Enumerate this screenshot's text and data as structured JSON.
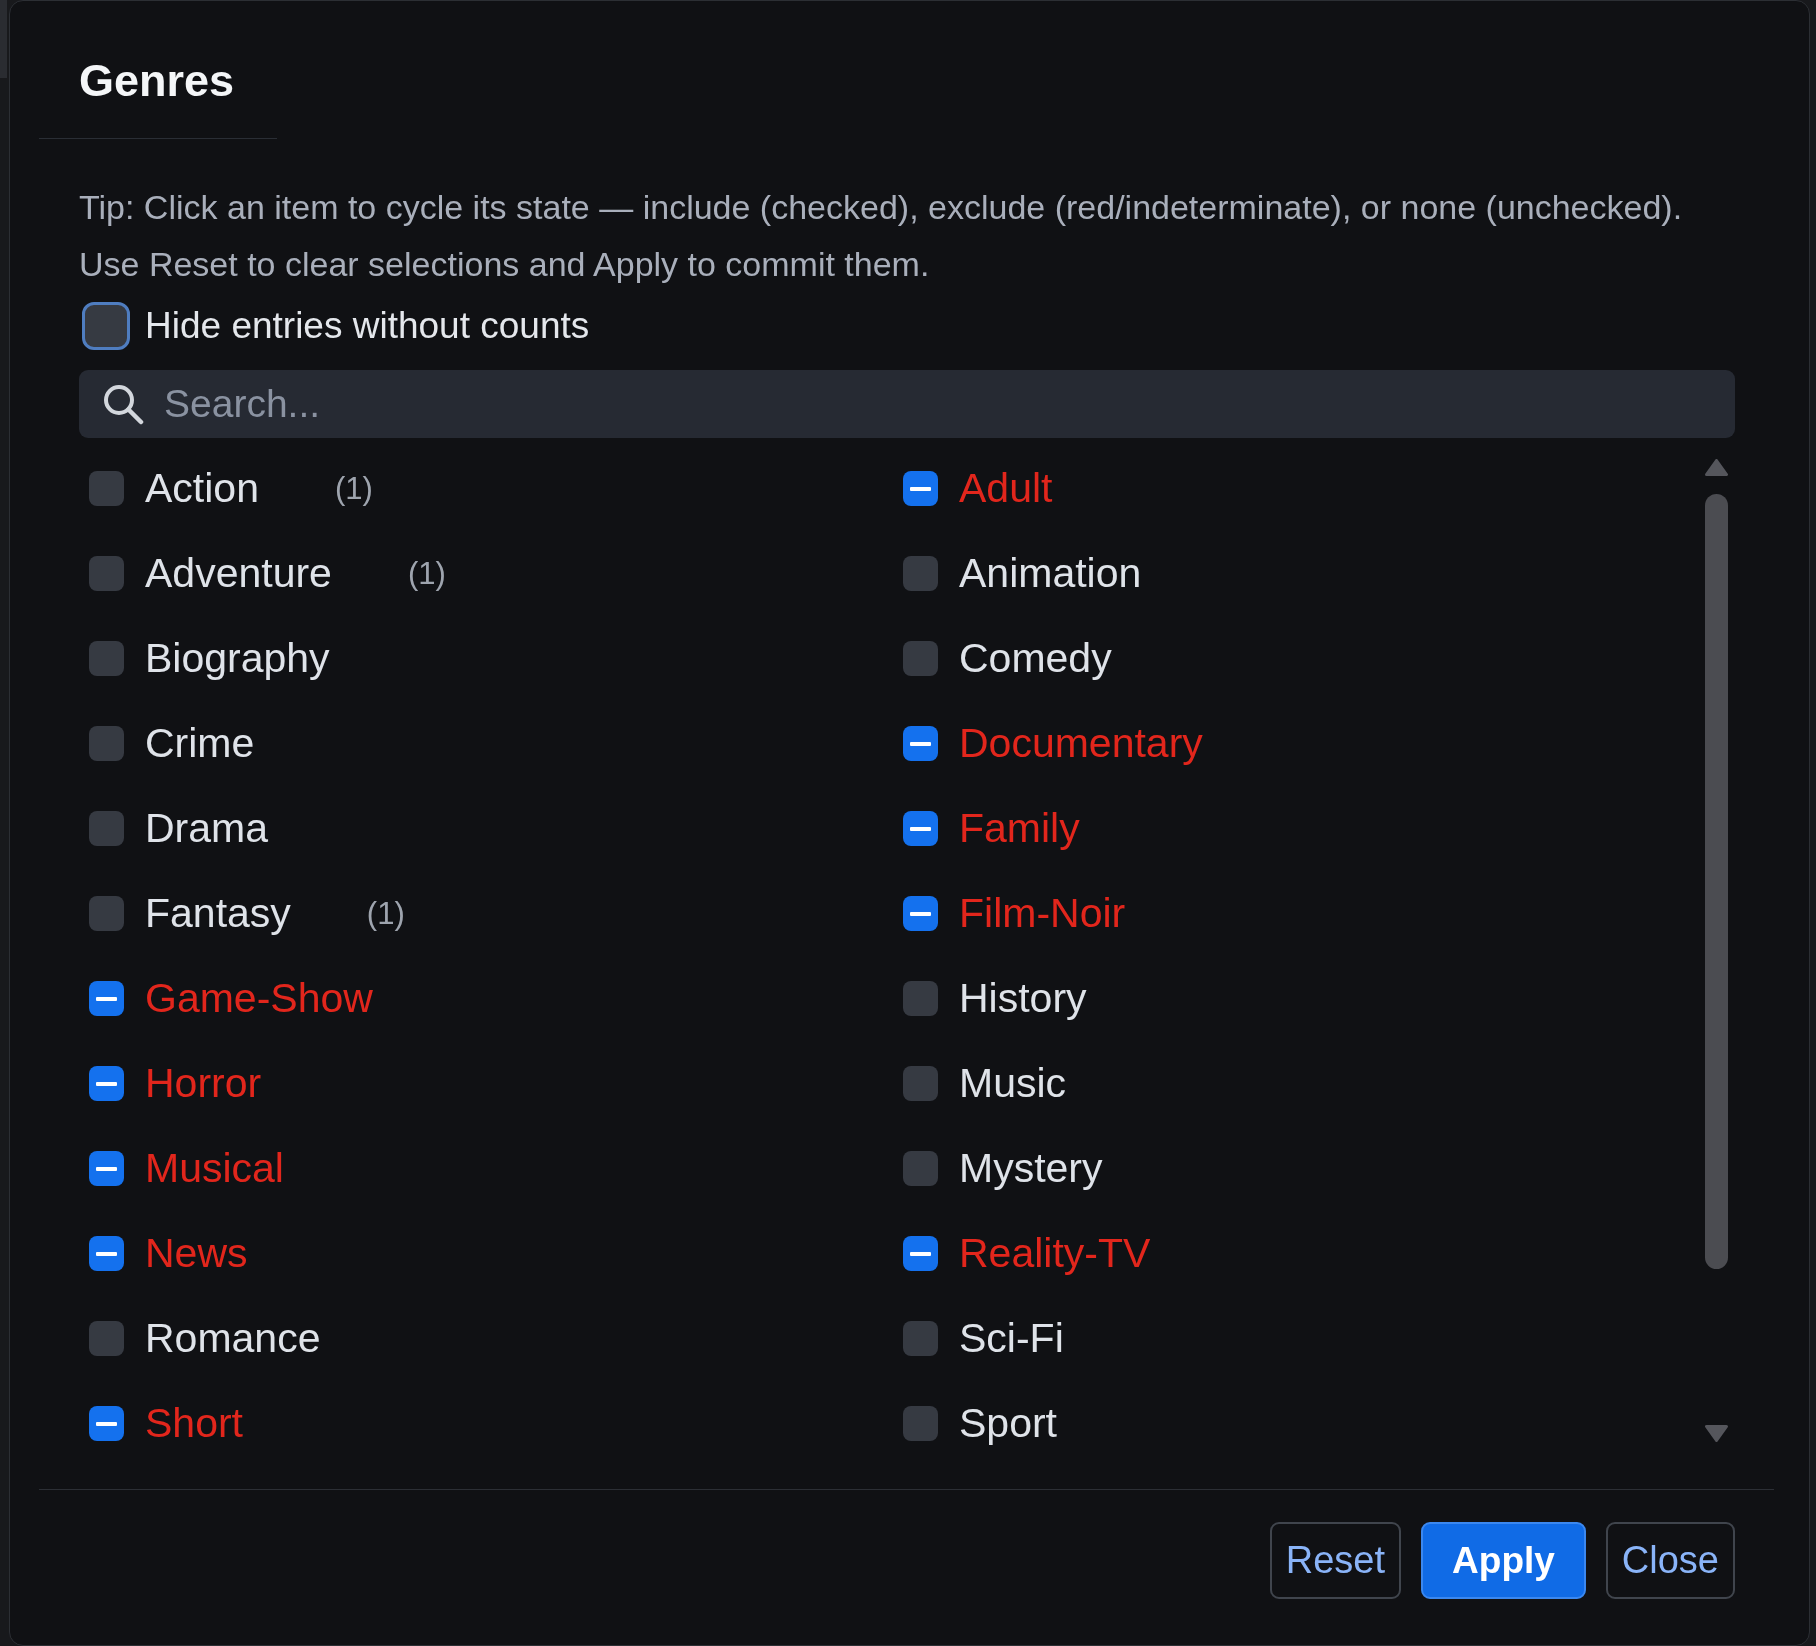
{
  "dialog": {
    "title": "Genres",
    "tip": [
      "Tip: Click an item to cycle its state — include (checked), exclude (red/indeterminate), or none (unchecked).",
      "Use Reset to clear selections and Apply to commit them."
    ],
    "hide_without_counts": {
      "label": "Hide entries without counts",
      "checked": false,
      "focused": true
    },
    "search": {
      "placeholder": "Search..."
    },
    "genres": [
      {
        "label": "Action",
        "excluded": false,
        "count": "(1)"
      },
      {
        "label": "Adult",
        "excluded": true
      },
      {
        "label": "Adventure",
        "excluded": false,
        "count": "(1)"
      },
      {
        "label": "Animation",
        "excluded": false
      },
      {
        "label": "Biography",
        "excluded": false
      },
      {
        "label": "Comedy",
        "excluded": false
      },
      {
        "label": "Crime",
        "excluded": false
      },
      {
        "label": "Documentary",
        "excluded": true
      },
      {
        "label": "Drama",
        "excluded": false
      },
      {
        "label": "Family",
        "excluded": true
      },
      {
        "label": "Fantasy",
        "excluded": false,
        "count": "(1)"
      },
      {
        "label": "Film-Noir",
        "excluded": true
      },
      {
        "label": "Game-Show",
        "excluded": true
      },
      {
        "label": "History",
        "excluded": false
      },
      {
        "label": "Horror",
        "excluded": true
      },
      {
        "label": "Music",
        "excluded": false
      },
      {
        "label": "Musical",
        "excluded": true
      },
      {
        "label": "Mystery",
        "excluded": false
      },
      {
        "label": "News",
        "excluded": true
      },
      {
        "label": "Reality-TV",
        "excluded": true
      },
      {
        "label": "Romance",
        "excluded": false
      },
      {
        "label": "Sci-Fi",
        "excluded": false
      },
      {
        "label": "Short",
        "excluded": true
      },
      {
        "label": "Sport",
        "excluded": false
      }
    ],
    "buttons": [
      {
        "label": "Reset",
        "kind": "reset"
      },
      {
        "label": "Apply",
        "kind": "apply"
      },
      {
        "label": "Close",
        "kind": "close"
      }
    ]
  }
}
